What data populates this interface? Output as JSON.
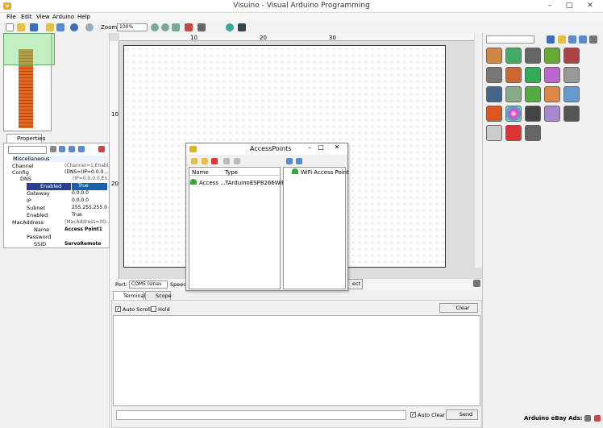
{
  "window": {
    "title": "Visuino - Visual Arduino Programming",
    "minimize": "–",
    "maximize": "□",
    "close": "✕"
  },
  "menu": [
    "File",
    "Edit",
    "View",
    "Arduino",
    "Help"
  ],
  "toolbar": {
    "zoom_label": "Zoom:",
    "zoom_value": "100%"
  },
  "ruler": {
    "top_ticks": [
      "10",
      "20",
      "30"
    ],
    "left_ticks": [
      "10",
      "20"
    ]
  },
  "properties": {
    "tab_label": "Properties",
    "rows": [
      {
        "label": "Miscellaneous",
        "value": ""
      },
      {
        "label": "Channel",
        "value": "(Channel=1,Enabl..."
      },
      {
        "label": "Config",
        "value": "(DNS=(IP=0.0.0..."
      },
      {
        "label": "DNS",
        "value": "(IP=0.0.0.0,En..."
      },
      {
        "label": "Enabled",
        "value": "True"
      },
      {
        "label": "Gateway",
        "value": "0.0.0.0"
      },
      {
        "label": "IP",
        "value": "0.0.0.0"
      },
      {
        "label": "Subnet",
        "value": "255.255.255.0"
      },
      {
        "label": "Enabled",
        "value": "True"
      },
      {
        "label": "MacAddress",
        "value": "(MacAddress=00-..."
      },
      {
        "label": "Name",
        "value": "Access Point1"
      },
      {
        "label": "Password",
        "value": ""
      },
      {
        "label": "SSID",
        "value": "ServoRemote"
      }
    ]
  },
  "dialog": {
    "title": "AccessPoints",
    "col_name": "Name",
    "col_type": "Type",
    "row_name": "Access ...",
    "row_type": "TArduinoESP8266WiF...",
    "right_item": "WiFi Access Point"
  },
  "serial": {
    "port_label": "Port:",
    "port_value": "COM5 (Unav",
    "speed_label": "Speed:",
    "connect_text": "ect",
    "tab_terminal": "Terminal",
    "tab_scope": "Scope",
    "auto_scroll": "Auto Scroll",
    "hold": "Hold",
    "clear": "Clear",
    "auto_clear": "Auto Clear",
    "send": "Send"
  },
  "footer": {
    "ads": "Arduino eBay Ads:"
  },
  "colors": {
    "accent": "#1e5fb4",
    "selection": "#2a3f8f",
    "component": "#e06a20"
  }
}
